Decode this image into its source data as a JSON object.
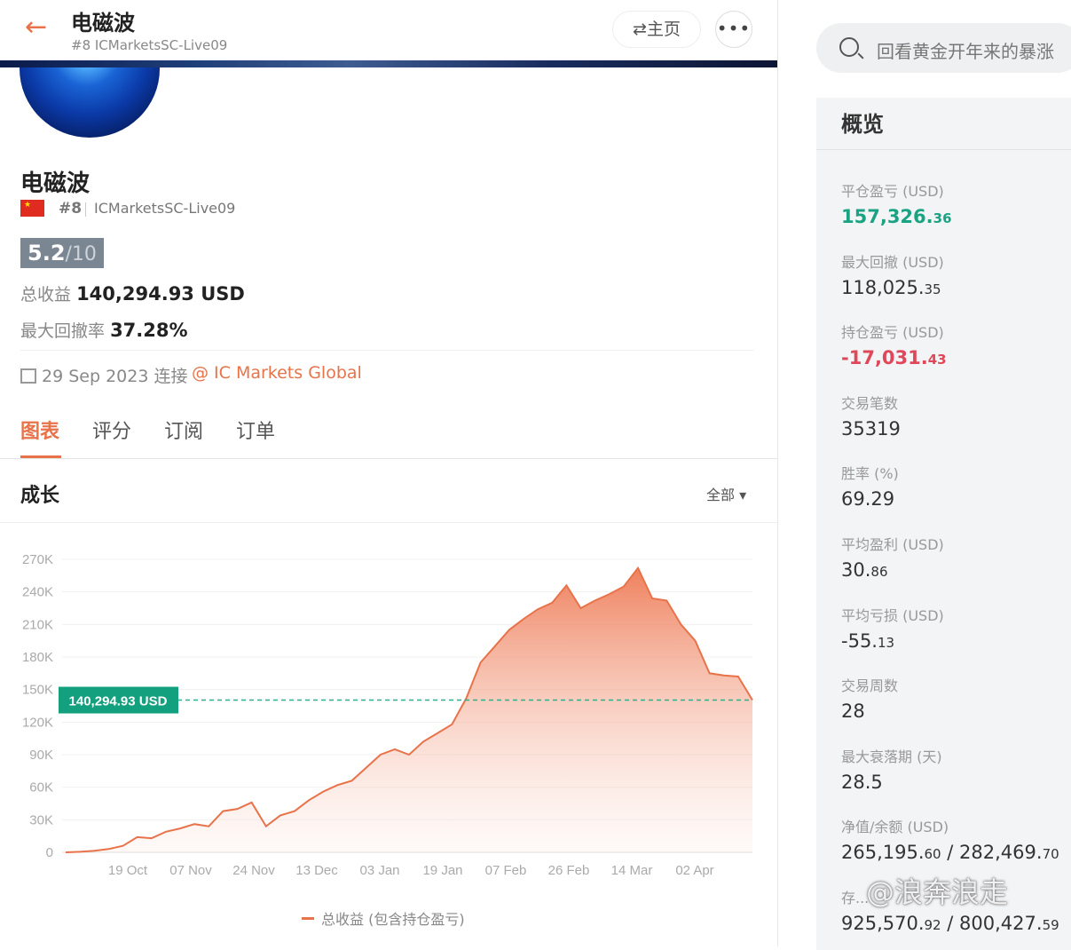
{
  "header": {
    "title": "电磁波",
    "subtitle": "#8  ICMarketsSC-Live09",
    "home_label": "⇄主页",
    "more_label": "•••"
  },
  "profile": {
    "name": "电磁波",
    "rank": "#8",
    "account": "ICMarketsSC-Live09",
    "score": "5.2",
    "score_max": "/10",
    "total_profit_label": "总收益",
    "total_profit_value": "140,294.93 USD",
    "max_drawdown_label": "最大回撤率",
    "max_drawdown_value": "37.28%",
    "since": "29 Sep 2023 连接",
    "broker": "@ IC Markets Global"
  },
  "tabs": [
    "图表",
    "评分",
    "订阅",
    "订单"
  ],
  "section": {
    "title": "成长",
    "range_label": "全部 ▾"
  },
  "chart_data": {
    "type": "area",
    "title": "",
    "y_ticks": [
      "270K",
      "240K",
      "210K",
      "180K",
      "150K",
      "120K",
      "90K",
      "60K",
      "30K",
      "0"
    ],
    "x_ticks": [
      "19 Oct",
      "07 Nov",
      "24 Nov",
      "13 Dec",
      "03 Jan",
      "19 Jan",
      "07 Feb",
      "26 Feb",
      "14 Mar",
      "02 Apr"
    ],
    "ylim": [
      0,
      270000
    ],
    "reference_line": {
      "value": 140294.93,
      "label": "140,294.93 USD"
    },
    "series": [
      {
        "name": "总收益 (包含持仓盈亏)",
        "values": [
          0,
          500,
          1500,
          3000,
          6000,
          14000,
          13000,
          19000,
          22000,
          26000,
          24000,
          38000,
          40000,
          46000,
          24000,
          34000,
          38000,
          48000,
          56000,
          62000,
          66000,
          78000,
          90000,
          95000,
          90000,
          102000,
          110000,
          118000,
          142000,
          175000,
          190000,
          205000,
          215000,
          224000,
          230000,
          246000,
          225000,
          232000,
          238000,
          245000,
          262000,
          234000,
          232000,
          210000,
          195000,
          165000,
          163000,
          162000,
          140294.93
        ]
      }
    ],
    "legend": "总收益 (包含持仓盈亏)"
  },
  "search": {
    "placeholder": "回看黄金开年来的暴涨"
  },
  "overview": {
    "title": "概览",
    "metrics": [
      {
        "label": "平仓盈亏 (USD)",
        "main": "157,326.",
        "dec": "36",
        "style": "green"
      },
      {
        "label": "最大回撤 (USD)",
        "main": "118,025.",
        "dec": "35",
        "style": ""
      },
      {
        "label": "持仓盈亏 (USD)",
        "main": "-17,031.",
        "dec": "43",
        "style": "red"
      },
      {
        "label": "交易笔数",
        "main": "35319",
        "dec": "",
        "style": ""
      },
      {
        "label": "胜率 (%)",
        "main": "69.29",
        "dec": "",
        "style": ""
      },
      {
        "label": "平均盈利 (USD)",
        "main": "30.",
        "dec": "86",
        "style": ""
      },
      {
        "label": "平均亏损 (USD)",
        "main": "-55.",
        "dec": "13",
        "style": ""
      },
      {
        "label": "交易周数",
        "main": "28",
        "dec": "",
        "style": ""
      },
      {
        "label": "最大衰落期 (天)",
        "main": "28.5",
        "dec": "",
        "style": ""
      },
      {
        "label": "净值/余额 (USD)",
        "main": "265,195.",
        "dec": "60",
        "main2": " / 282,469.",
        "dec2": "70",
        "style": ""
      },
      {
        "label": "存...",
        "main": "925,570.",
        "dec": "92",
        "main2": " / 800,427.",
        "dec2": "59",
        "style": ""
      }
    ]
  },
  "watermark": "@浪奔浪走",
  "colors": {
    "accent": "#e8734a",
    "green": "#1aa383",
    "red": "#e0475a"
  }
}
